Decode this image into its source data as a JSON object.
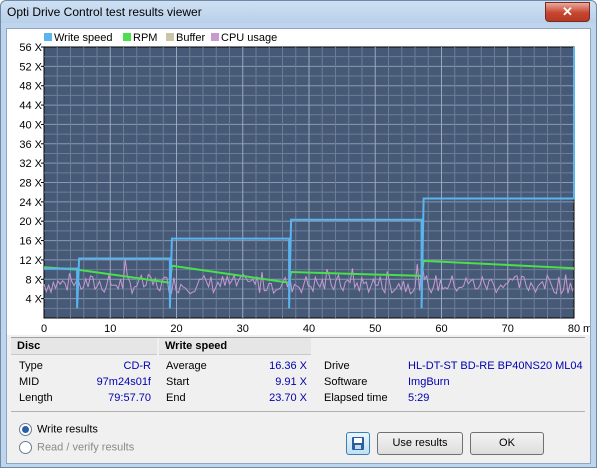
{
  "window": {
    "title": "Opti Drive Control test results viewer",
    "close_glyph": "✕"
  },
  "chart_data": {
    "type": "line",
    "x": {
      "label": "",
      "unit_label": "min",
      "min": 0,
      "max": 80,
      "ticks": [
        0,
        10,
        20,
        30,
        40,
        50,
        60,
        70,
        80
      ]
    },
    "y": {
      "min": 0,
      "max": 56,
      "ticks": [
        4,
        8,
        12,
        16,
        20,
        24,
        28,
        32,
        36,
        40,
        44,
        48,
        52,
        56
      ],
      "tick_suffix": " X"
    },
    "legend": [
      {
        "name": "Write speed",
        "color": "#5ab4ee"
      },
      {
        "name": "RPM",
        "color": "#49e04c"
      },
      {
        "name": "Buffer",
        "color": "#c9c5a6"
      },
      {
        "name": "CPU usage",
        "color": "#c89ad0"
      }
    ],
    "plot_background": "#465a78",
    "grid": true,
    "series": [
      {
        "name": "Write speed",
        "color": "#5ab4ee",
        "points": [
          [
            0,
            10.2
          ],
          [
            5,
            10.2
          ],
          [
            5,
            2
          ],
          [
            5.3,
            12.3
          ],
          [
            19,
            12.3
          ],
          [
            19,
            2
          ],
          [
            19.3,
            16.4
          ],
          [
            37,
            16.4
          ],
          [
            37,
            2
          ],
          [
            37.3,
            20.3
          ],
          [
            57,
            20.3
          ],
          [
            57,
            2
          ],
          [
            57.3,
            24.7
          ],
          [
            80,
            24.7
          ],
          [
            80,
            56
          ]
        ]
      },
      {
        "name": "RPM",
        "color": "#49e04c",
        "points": [
          [
            0,
            10.5
          ],
          [
            5,
            10.0
          ],
          [
            19,
            7.3
          ],
          [
            19.3,
            10.8
          ],
          [
            37,
            7.3
          ],
          [
            37.3,
            9.5
          ],
          [
            57,
            8.7
          ],
          [
            57.3,
            11.8
          ],
          [
            80,
            10.3
          ]
        ]
      },
      {
        "name": "CPU usage",
        "color": "#c89ad0",
        "values_range": [
          5,
          9
        ]
      }
    ]
  },
  "disc": {
    "heading": "Disc",
    "rows": [
      {
        "label": "Type",
        "value": "CD-R"
      },
      {
        "label": "MID",
        "value": "97m24s01f"
      },
      {
        "label": "Length",
        "value": "79:57.70"
      }
    ]
  },
  "write_speed": {
    "heading": "Write speed",
    "rows": [
      {
        "label": "Average",
        "value": "16.36 X"
      },
      {
        "label": "Start",
        "value": "9.91 X"
      },
      {
        "label": "End",
        "value": "23.70 X"
      }
    ]
  },
  "drive_info": {
    "rows": [
      {
        "label": "Drive",
        "value": "HL-DT-ST  BD-RE BP40NS20 ML04"
      },
      {
        "label": "Software",
        "value": "ImgBurn"
      },
      {
        "label": "Elapsed time",
        "value": "5:29"
      }
    ]
  },
  "options": {
    "write_results": "Write results",
    "read_verify_results": "Read / verify results",
    "selected": "write_results"
  },
  "buttons": {
    "use_results": "Use results",
    "ok": "OK"
  }
}
